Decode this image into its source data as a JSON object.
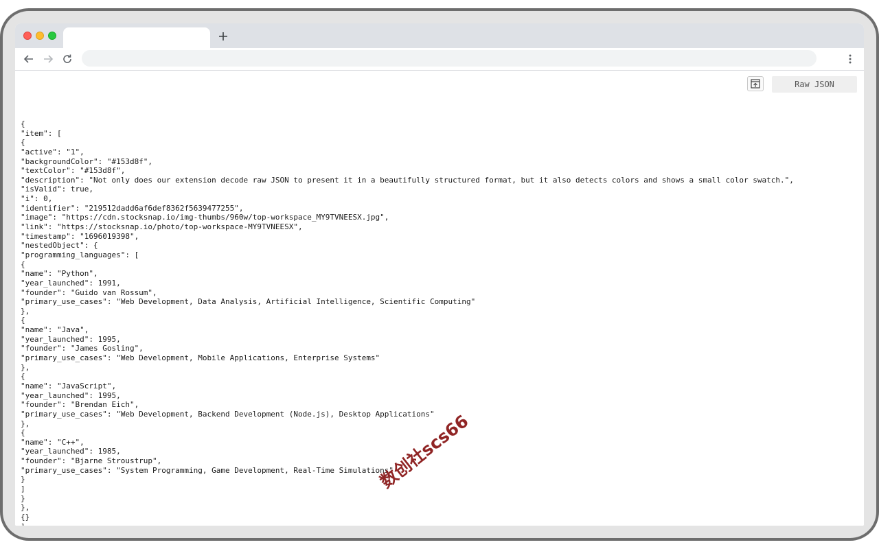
{
  "browser": {
    "tab_title": "",
    "new_tab_icon": "plus-icon",
    "address": "",
    "icons": {
      "back": "arrow-left-icon",
      "forward": "arrow-right-icon",
      "reload": "reload-icon",
      "menu": "more-vertical-icon"
    }
  },
  "viewer": {
    "raw_button_label": "Raw JSON",
    "open_icon": "open-in-window-icon"
  },
  "json_lines": [
    "{",
    "\"item\": [",
    "{",
    "\"active\": \"1\",",
    "\"backgroundColor\": \"#153d8f\",",
    "\"textColor\": \"#153d8f\",",
    "\"description\": \"Not only does our extension decode raw JSON to present it in a beautifully structured format, but it also detects colors and shows a small color swatch.\",",
    "\"isValid\": true,",
    "\"i\": 0,",
    "\"identifier\": \"219512dadd6af6def8362f5639477255\",",
    "\"image\": \"https://cdn.stocksnap.io/img-thumbs/960w/top-workspace_MY9TVNEESX.jpg\",",
    "\"link\": \"https://stocksnap.io/photo/top-workspace-MY9TVNEESX\",",
    "\"timestamp\": \"1696019398\",",
    "\"nestedObject\": {",
    "\"programming_languages\": [",
    "{",
    "\"name\": \"Python\",",
    "\"year_launched\": 1991,",
    "\"founder\": \"Guido van Rossum\",",
    "\"primary_use_cases\": \"Web Development, Data Analysis, Artificial Intelligence, Scientific Computing\"",
    "},",
    "{",
    "\"name\": \"Java\",",
    "\"year_launched\": 1995,",
    "\"founder\": \"James Gosling\",",
    "\"primary_use_cases\": \"Web Development, Mobile Applications, Enterprise Systems\"",
    "},",
    "{",
    "\"name\": \"JavaScript\",",
    "\"year_launched\": 1995,",
    "\"founder\": \"Brendan Eich\",",
    "\"primary_use_cases\": \"Web Development, Backend Development (Node.js), Desktop Applications\"",
    "},",
    "{",
    "\"name\": \"C++\",",
    "\"year_launched\": 1985,",
    "\"founder\": \"Bjarne Stroustrup\",",
    "\"primary_use_cases\": \"System Programming, Game Development, Real-Time Simulations\"",
    "}",
    "]",
    "}",
    "},",
    "{}",
    "]",
    "}"
  ],
  "watermark": "数创社scs66",
  "colors": {
    "frame": "#6d6d6d",
    "tabstrip": "#dee1e6",
    "omnibox": "#f1f3f4",
    "watermark": "#8b1a1a",
    "traffic_close": "#ff5f57",
    "traffic_minimize": "#febc2e",
    "traffic_maximize": "#28c840"
  }
}
